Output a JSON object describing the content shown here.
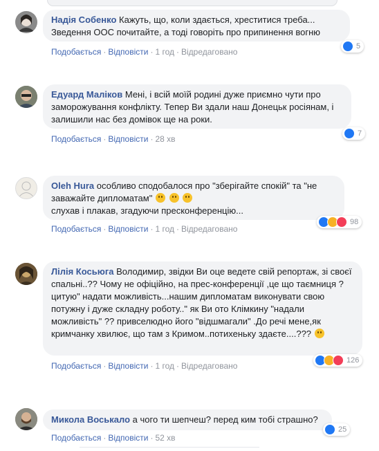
{
  "comments": [
    {
      "author": "Надія Собенко",
      "text": "Кажуть, що, коли здається, хреститися треба... Зведення ООС почитайте, а тоді говоріть про припинення вогню",
      "like_label": "Подобається",
      "reply_label": "Відповісти",
      "time": "1 год",
      "edited": "Відредаговано",
      "reactions": [
        "like"
      ],
      "reaction_count": "5"
    },
    {
      "author": "Едуард Маліков",
      "text": "Мені, і всій моїй родині дуже приємно чути про заморожування конфлікту. Тепер Ви здали наш Донецьк росіянам, і залишили нас без домівок ще на роки.",
      "like_label": "Подобається",
      "reply_label": "Відповісти",
      "time": "28 хв",
      "reactions": [
        "like"
      ],
      "reaction_count": "7"
    },
    {
      "author": "Oleh Hura",
      "text": "особливо сподобалося про \"зберігайте спокій\" та \"не заважайте дипломатам\"",
      "text2": "слухав і плакав, згадуючи пресконференцію...",
      "like_label": "Подобається",
      "reply_label": "Відповісти",
      "time": "1 год",
      "edited": "Відредаговано",
      "reactions": [
        "like",
        "haha",
        "love"
      ],
      "reaction_count": "98"
    },
    {
      "author": "Лілія Косьюга",
      "text": "Володимир, звідки Ви оце ведете свій репортаж, зі своєї спальні..?? Чому не офіційно, на прес-конференції ,це що таємниця ? цитую\" надати можливість...нашим дипломатам виконувати свою потужну і дуже складну роботу..\" як Ви ото Клімкину \"надали можливість\" ?? привселюдно його \"відшмагали\" .До речі мене,як кримчанку хвилює, що там з Кримом..потихеньку здаєте....???",
      "like_label": "Подобається",
      "reply_label": "Відповісти",
      "time": "1 год",
      "edited": "Відредаговано",
      "reactions": [
        "like",
        "haha",
        "love"
      ],
      "reaction_count": "126"
    },
    {
      "author": "Микола Воськало",
      "text": "а чого ти шепчеш? перед ким тобі страшно?",
      "like_label": "Подобається",
      "reply_label": "Відповісти",
      "time": "52 хв",
      "reactions": [
        "like"
      ],
      "reaction_count": "25"
    }
  ],
  "colors": {
    "author": "#385898",
    "link": "#4267b2",
    "bubble": "#f2f3f5",
    "muted": "#90949c"
  }
}
